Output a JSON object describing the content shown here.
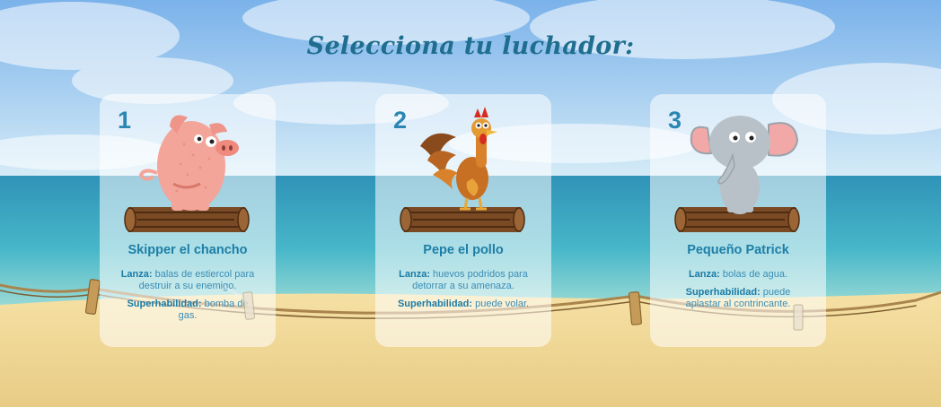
{
  "title": "Selecciona tu luchador:",
  "fighters": [
    {
      "number": "1",
      "name": "Skipper el chancho",
      "lance_label": "Lanza:",
      "lance_text": "balas de estiercol para destruir a su enemigo.",
      "super_label": "Superhabilidad:",
      "super_text": "bomba de gas.",
      "animal": "pig"
    },
    {
      "number": "2",
      "name": "Pepe el pollo",
      "lance_label": "Lanza:",
      "lance_text": "huevos podridos para detorrar a su amenaza.",
      "super_label": "Superhabilidad:",
      "super_text": "puede volar.",
      "animal": "rooster"
    },
    {
      "number": "3",
      "name": "Pequeño Patrick",
      "lance_label": "Lanza:",
      "lance_text": "bolas de agua.",
      "super_label": "Superhabilidad:",
      "super_text": "puede aplastar al contrincante.",
      "animal": "elephant"
    }
  ],
  "colors": {
    "title": "#1f6e8f",
    "name": "#1d7fa6",
    "number": "#2a86b2",
    "sky_top": "#76b1ea",
    "sea": "#2d9fc0",
    "sand": "#f0d796"
  }
}
